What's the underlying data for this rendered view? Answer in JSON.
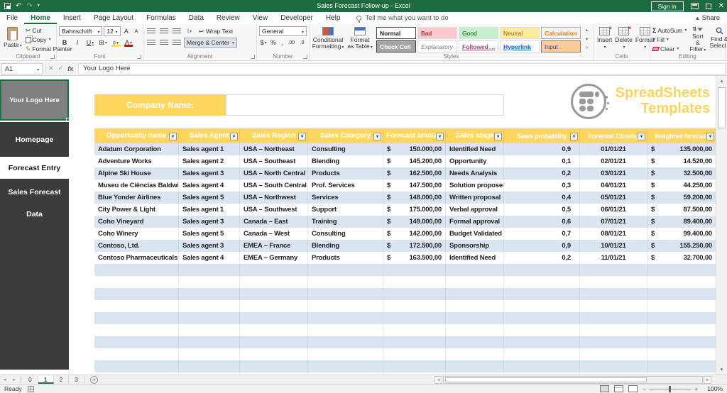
{
  "title_bar": {
    "title": "Sales Forecast Follow-up  -  Excel",
    "sign_in_label": "Sign in"
  },
  "ribbon_tabs": {
    "file": "File",
    "home": "Home",
    "insert": "Insert",
    "page_layout": "Page Layout",
    "formulas": "Formulas",
    "data": "Data",
    "review": "Review",
    "view": "View",
    "developer": "Developer",
    "help": "Help",
    "tell_me": "Tell me what you want to do",
    "share": "Share"
  },
  "ribbon": {
    "clipboard": {
      "group_label": "Clipboard",
      "paste": "Paste",
      "cut": "Cut",
      "copy": "Copy",
      "format_painter": "Format Painter"
    },
    "font": {
      "group_label": "Font",
      "name": "Bahnschrift",
      "size": "12",
      "bold": "B",
      "italic": "I",
      "underline": "U"
    },
    "alignment": {
      "group_label": "Alignment",
      "wrap_text": "Wrap Text",
      "merge_center": "Merge & Center"
    },
    "number": {
      "group_label": "Number",
      "format": "General",
      "currency": "$",
      "percent": "%",
      "comma": ",",
      "inc_dec": ".00",
      "dec_dec": ".0"
    },
    "styles": {
      "group_label": "Styles",
      "conditional_formatting": "Conditional Formatting",
      "format_as_table": "Format as Table",
      "gallery": [
        "Normal",
        "Bad",
        "Good",
        "Neutral",
        "Calculation",
        "Check Cell",
        "Explanatory ...",
        "Followed ...",
        "Hyperlink",
        "Input"
      ]
    },
    "cells": {
      "group_label": "Cells",
      "insert": "Insert",
      "delete": "Delete",
      "format": "Format"
    },
    "editing": {
      "group_label": "Editing",
      "autosum": "AutoSum",
      "fill": "Fill",
      "clear": "Clear",
      "sort_filter": "Sort & Filter",
      "find_select": "Find & Select"
    }
  },
  "formula_bar": {
    "name_box": "A1",
    "value": "Your Logo Here"
  },
  "sidebar": {
    "logo_cell_text": "Your Logo Here",
    "homepage": "Homepage",
    "forecast_entry": "Forecast Entry",
    "sales_forecast": "Sales Forecast",
    "data": "Data"
  },
  "page": {
    "company_label": "Company Name:",
    "company_value": "",
    "brand_line1": "SpreadSheets",
    "brand_line2": "Templates"
  },
  "table": {
    "currency_symbol": "$",
    "headers": [
      "Opportunity name",
      "Sales Agent",
      "Sales Region",
      "Sales Category",
      "Forecast amount",
      "Sales stage",
      "Sales probability",
      "Forecast Closing",
      "Weighted forecast"
    ],
    "rows": [
      {
        "opportunity": "Adatum Corporation",
        "agent": "Sales agent 1",
        "region": "USA – Northeast",
        "category": "Consulting",
        "amount": "150.000,00",
        "stage": "Identified Need",
        "probability": "0,9",
        "closing": "01/01/21",
        "weighted": "135.000,00"
      },
      {
        "opportunity": "Adventure Works",
        "agent": "Sales agent 2",
        "region": "USA – Southeast",
        "category": "Blending",
        "amount": "145.200,00",
        "stage": "Opportunity",
        "probability": "0,1",
        "closing": "02/01/21",
        "weighted": "14.520,00"
      },
      {
        "opportunity": "Alpine Ski House",
        "agent": "Sales agent 3",
        "region": "USA – North Central",
        "category": "Products",
        "amount": "162.500,00",
        "stage": "Needs Analysis",
        "probability": "0,2",
        "closing": "03/01/21",
        "weighted": "32.500,00"
      },
      {
        "opportunity": "Museu de Ciências Baldwin",
        "agent": "Sales agent 4",
        "region": "USA – South Central",
        "category": "Prof. Services",
        "amount": "147.500,00",
        "stage": "Solution proposed",
        "probability": "0,3",
        "closing": "04/01/21",
        "weighted": "44.250,00"
      },
      {
        "opportunity": "Blue Yonder Airlines",
        "agent": "Sales agent 5",
        "region": "USA – Northwest",
        "category": "Services",
        "amount": "148.000,00",
        "stage": "Written proposal",
        "probability": "0,4",
        "closing": "05/01/21",
        "weighted": "59.200,00"
      },
      {
        "opportunity": "City Power & Light",
        "agent": "Sales agent 1",
        "region": "USA – Southwest",
        "category": "Support",
        "amount": "175.000,00",
        "stage": "Verbal approval",
        "probability": "0,5",
        "closing": "06/01/21",
        "weighted": "87.500,00"
      },
      {
        "opportunity": "Coho Vineyard",
        "agent": "Sales agent 3",
        "region": "Canada – East",
        "category": "Training",
        "amount": "149.000,00",
        "stage": "Formal approval",
        "probability": "0,6",
        "closing": "07/01/21",
        "weighted": "89.400,00"
      },
      {
        "opportunity": "Coho Winery",
        "agent": "Sales agent 5",
        "region": "Canada – West",
        "category": "Consulting",
        "amount": "142.000,00",
        "stage": "Budget Validated",
        "probability": "0,7",
        "closing": "08/01/21",
        "weighted": "99.400,00"
      },
      {
        "opportunity": "Contoso, Ltd.",
        "agent": "Sales agent 3",
        "region": "EMEA – France",
        "category": "Blending",
        "amount": "172.500,00",
        "stage": "Sponsorship",
        "probability": "0,9",
        "closing": "10/01/21",
        "weighted": "155.250,00"
      },
      {
        "opportunity": "Contoso Pharmaceuticals",
        "agent": "Sales agent 4",
        "region": "EMEA – Germany",
        "category": "Products",
        "amount": "163.500,00",
        "stage": "Identified Need",
        "probability": "0,2",
        "closing": "11/01/21",
        "weighted": "32.700,00"
      }
    ],
    "empty_rows": 10
  },
  "sheet_tabs": {
    "tabs": [
      "0",
      "1",
      "2",
      "3"
    ],
    "active_index": 1
  },
  "status_bar": {
    "mode": "Ready",
    "zoom_level": "100%"
  },
  "icons": {
    "undo": "↶",
    "redo": "↷",
    "close": "✕",
    "cancel": "✕",
    "confirm": "✓",
    "function": "fx",
    "cut": "✂",
    "format_painter": "✎",
    "borders": "⊞",
    "autosum": "Σ",
    "sort_az": "⇅",
    "arrow_up": "▴",
    "arrow_down": "▾",
    "arrow_left": "◂",
    "arrow_right": "▸",
    "plus": "+",
    "minus": "−",
    "wrap": "↩",
    "grow_font": "A",
    "shrink_font": "A"
  },
  "colors": {
    "titlebar_green": "#1e6b41",
    "accent_green": "#1e7145",
    "header_yellow": "#ffd75e",
    "band_blue": "#dbe5f2",
    "sidebar_dark": "#3b3b3b",
    "logo_gray": "#808080",
    "brand_yellow": "#f9d45f"
  }
}
